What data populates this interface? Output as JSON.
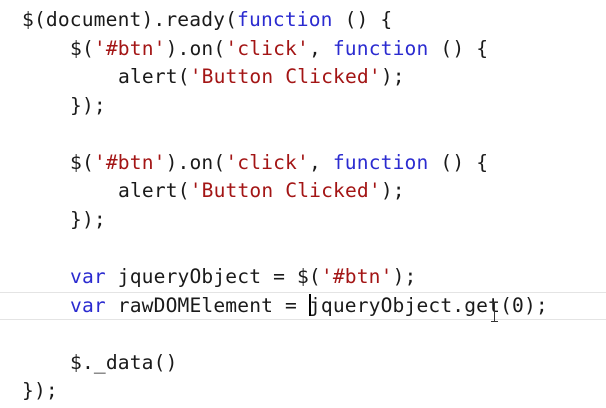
{
  "editor": {
    "lines": [
      {
        "indent": 0,
        "tokens": [
          {
            "t": "$(document).ready(",
            "c": ""
          },
          {
            "t": "function",
            "c": "kw"
          },
          {
            "t": " () {",
            "c": ""
          }
        ]
      },
      {
        "indent": 1,
        "tokens": [
          {
            "t": "$(",
            "c": ""
          },
          {
            "t": "'#btn'",
            "c": "str"
          },
          {
            "t": ").on(",
            "c": ""
          },
          {
            "t": "'click'",
            "c": "str"
          },
          {
            "t": ", ",
            "c": ""
          },
          {
            "t": "function",
            "c": "kw"
          },
          {
            "t": " () {",
            "c": ""
          }
        ]
      },
      {
        "indent": 2,
        "tokens": [
          {
            "t": "alert(",
            "c": ""
          },
          {
            "t": "'Button Clicked'",
            "c": "str"
          },
          {
            "t": ");",
            "c": ""
          }
        ]
      },
      {
        "indent": 1,
        "tokens": [
          {
            "t": "});",
            "c": ""
          }
        ]
      },
      {
        "indent": 0,
        "tokens": []
      },
      {
        "indent": 1,
        "tokens": [
          {
            "t": "$(",
            "c": ""
          },
          {
            "t": "'#btn'",
            "c": "str"
          },
          {
            "t": ").on(",
            "c": ""
          },
          {
            "t": "'click'",
            "c": "str"
          },
          {
            "t": ", ",
            "c": ""
          },
          {
            "t": "function",
            "c": "kw"
          },
          {
            "t": " () {",
            "c": ""
          }
        ]
      },
      {
        "indent": 2,
        "tokens": [
          {
            "t": "alert(",
            "c": ""
          },
          {
            "t": "'Button Clicked'",
            "c": "str"
          },
          {
            "t": ");",
            "c": ""
          }
        ]
      },
      {
        "indent": 1,
        "tokens": [
          {
            "t": "});",
            "c": ""
          }
        ]
      },
      {
        "indent": 0,
        "tokens": []
      },
      {
        "indent": 1,
        "tokens": [
          {
            "t": "var",
            "c": "kw"
          },
          {
            "t": " jqueryObject = $(",
            "c": ""
          },
          {
            "t": "'#btn'",
            "c": "str"
          },
          {
            "t": ");",
            "c": ""
          }
        ]
      },
      {
        "indent": 1,
        "tokens": [
          {
            "t": "var",
            "c": "kw"
          },
          {
            "t": " rawDOMElement = jqueryObject.get(0);",
            "c": ""
          }
        ]
      },
      {
        "indent": 0,
        "tokens": []
      },
      {
        "indent": 1,
        "tokens": [
          {
            "t": "$._data()",
            "c": ""
          }
        ]
      },
      {
        "indent": 0,
        "tokens": [
          {
            "t": "});",
            "c": ""
          }
        ]
      }
    ],
    "current_line": 11,
    "colors": {
      "keyword": "#2b2bd0",
      "string": "#a31515",
      "text": "#1a1a1a"
    }
  }
}
